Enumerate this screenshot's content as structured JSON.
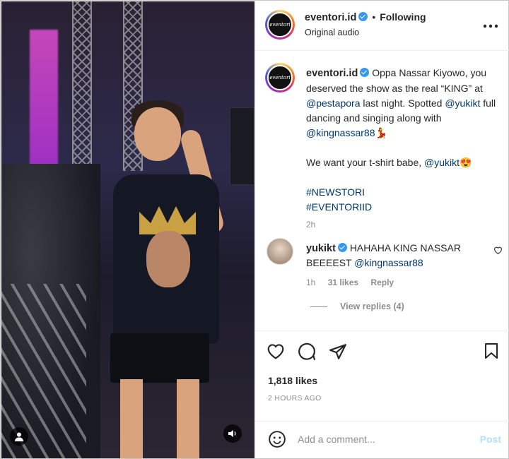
{
  "post": {
    "username": "eventori.id",
    "avatar_text": "eventori",
    "follow_status": "Following",
    "separator": "•",
    "audio": "Original audio",
    "more_label": "•••"
  },
  "caption": {
    "username": "eventori.id",
    "line1_prefix": "Oppa Nassar Kiyowo, you deserved the show as the real “KING” at ",
    "mention_pestapora": "@pestapora",
    "line1_suffix": " last night. Spotted ",
    "mention_yukikt": "@yukikt",
    "line2_mid": " full dancing and singing along with ",
    "mention_kingnassar": "@kingnassar88",
    "emoji_dancer": "💃",
    "line3_prefix": "We want your t-shirt babe, ",
    "mention_yukikt2": "@yukikt",
    "emoji_heart_eyes": "😍",
    "hashtag1": "#NEWSTORI",
    "hashtag2": "#EVENTORIID",
    "time": "2h"
  },
  "comment": {
    "username": "yukikt",
    "text": "HAHAHA KING NASSAR BEEEEST ",
    "mention": "@kingnassar88",
    "time": "1h",
    "likes": "31 likes",
    "reply": "Reply",
    "view_replies": "View replies (4)"
  },
  "engagement": {
    "likes": "1,818 likes",
    "posted": "2 HOURS AGO"
  },
  "add_comment": {
    "placeholder": "Add a comment...",
    "post_label": "Post"
  },
  "icons": {
    "like": "heart-icon",
    "comment": "comment-icon",
    "share": "share-icon",
    "save": "bookmark-icon",
    "emoji": "emoji-icon",
    "user": "user-tag-icon",
    "sound": "speaker-icon"
  },
  "colors": {
    "link": "#00376b",
    "verified": "#3897f0",
    "muted": "#8e8e8e",
    "post_disabled": "#b2dffc"
  }
}
